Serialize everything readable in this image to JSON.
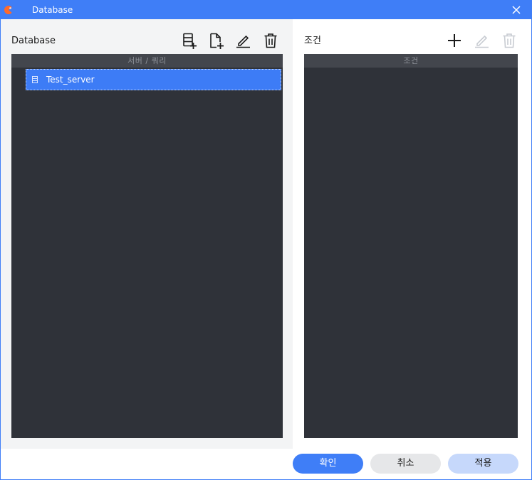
{
  "window": {
    "title": "Database"
  },
  "left_panel": {
    "title": "Database",
    "toolbar": {
      "add_server": "add-server-icon",
      "add_query": "add-query-icon",
      "edit": "edit-icon",
      "delete": "delete-icon"
    },
    "list_header": "서버 / 쿼리",
    "items": [
      {
        "label": "Test_server",
        "selected": true
      }
    ]
  },
  "right_panel": {
    "title": "조건",
    "toolbar": {
      "add": "add-icon",
      "edit": "edit-icon",
      "delete": "delete-icon"
    },
    "list_header": "조건"
  },
  "footer": {
    "ok_label": "확인",
    "cancel_label": "취소",
    "apply_label": "적용"
  },
  "colors": {
    "accent": "#3f7ef7",
    "list_bg": "#2f3239",
    "list_header_bg": "#43464d",
    "selected_row": "#3d7cf6",
    "apply_btn": "#c6d8fb",
    "disabled_icon": "#c8ccd2"
  }
}
